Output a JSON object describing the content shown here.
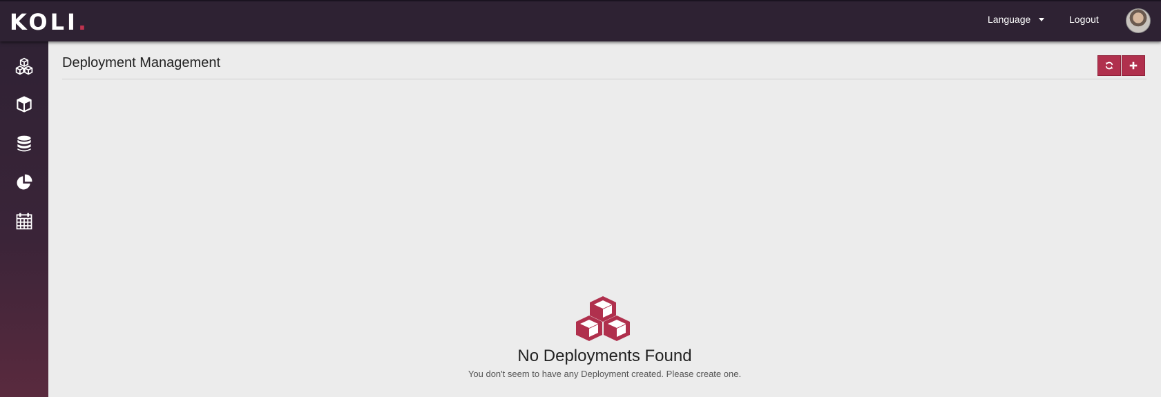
{
  "app": {
    "logo_text": "KOLI",
    "logo_dot": ".",
    "accent_color": "#b0304d"
  },
  "topbar": {
    "language_label": "Language",
    "logout_label": "Logout"
  },
  "sidebar": {
    "items": [
      {
        "icon": "cubes-icon"
      },
      {
        "icon": "cube-icon"
      },
      {
        "icon": "database-icon"
      },
      {
        "icon": "pie-chart-icon"
      },
      {
        "icon": "calendar-icon"
      }
    ]
  },
  "page": {
    "title": "Deployment Management",
    "buttons": [
      {
        "icon": "refresh-icon"
      },
      {
        "icon": "plus-icon"
      }
    ]
  },
  "empty_state": {
    "icon": "cubes-icon",
    "title": "No Deployments Found",
    "message": "You don't seem to have any Deployment created. Please create one."
  }
}
